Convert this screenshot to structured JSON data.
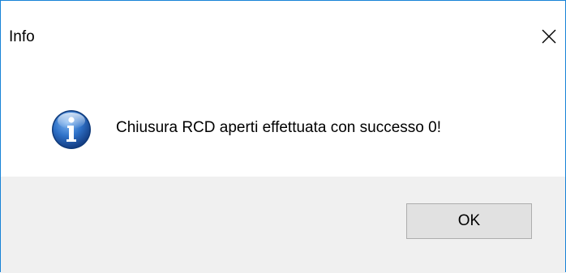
{
  "dialog": {
    "title": "Info",
    "close_icon": "close-icon",
    "message": "Chiusura RCD aperti effettuata con successo 0!",
    "icon": "info-icon",
    "ok_label": "OK"
  },
  "colors": {
    "border": "#1883d7",
    "footer_bg": "#f0f0f0",
    "button_bg": "#e1e1e1",
    "button_border": "#adadad",
    "icon_blue": "#1f5fb0"
  }
}
